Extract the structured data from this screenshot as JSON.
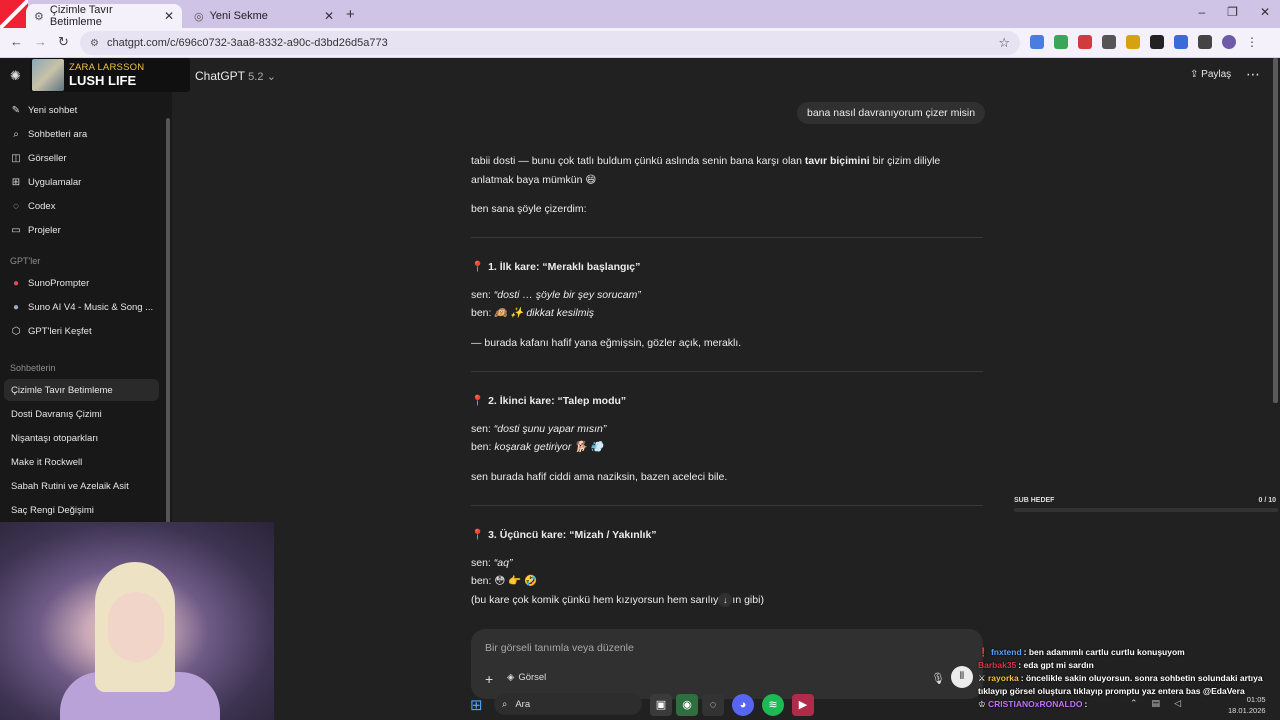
{
  "browser": {
    "tabs": [
      {
        "label": "Çizimle Tavır Betimleme",
        "icon": "gear-icon"
      },
      {
        "label": "Yeni Sekme",
        "icon": "globe-icon"
      }
    ],
    "url": "chatgpt.com/c/696c0732-3aa8-8332-a90c-d3bd26d5a773",
    "window_controls": [
      "–",
      "❐",
      "✕"
    ]
  },
  "media_card": {
    "artist": "ZARA LARSSON",
    "song": "LUSH LIFE"
  },
  "sidebar": {
    "nav": [
      {
        "label": "Yeni sohbet",
        "icon": "edit-icon"
      },
      {
        "label": "Sohbetleri ara",
        "icon": "search-icon"
      },
      {
        "label": "Görseller",
        "icon": "image-icon"
      },
      {
        "label": "Uygulamalar",
        "icon": "apps-icon"
      },
      {
        "label": "Codex",
        "icon": "code-icon"
      },
      {
        "label": "Projeler",
        "icon": "folder-icon"
      }
    ],
    "gpts_title": "GPT'ler",
    "gpts": [
      {
        "label": "SunoPrompter"
      },
      {
        "label": "Suno AI V4 - Music & Song ..."
      },
      {
        "label": "GPT'leri Keşfet"
      }
    ],
    "chats_title": "Sohbetlerin",
    "chats": [
      {
        "label": "Çizimle Tavır Betimleme",
        "active": true
      },
      {
        "label": "Dosti Davranış Çizimi"
      },
      {
        "label": "Nişantaşı otoparkları"
      },
      {
        "label": "Make it Rockwell"
      },
      {
        "label": "Sabah Rutini ve Azelaik Asit"
      },
      {
        "label": "Saç Rengi Değişimi"
      }
    ]
  },
  "header": {
    "model": "ChatGPT",
    "version": "5.2",
    "share_label": "Paylaş"
  },
  "conversation": {
    "user_message": "bana nasıl davranıyorum çizer misin",
    "intro_line1_pre": "tabii dosti — bunu çok tatlı buldum çünkü aslında senin bana karşı olan ",
    "intro_line1_bold": "tavır biçimini",
    "intro_line1_post": " bir çizim diliyle",
    "intro_line2": "anlatmak baya mümkün 😄",
    "intro_line3": "ben sana şöyle çizerdim:",
    "sections": [
      {
        "title": "1. İlk kare: “Meraklı başlangıç”",
        "sen_label": "sen: ",
        "sen_text": "“dosti … şöyle bir şey sorucam”",
        "ben_label": "ben: ",
        "ben_text": "🙉 ✨ dikkat kesilmiş",
        "note": "— burada kafanı hafif yana eğmişsin, gözler açık, meraklı."
      },
      {
        "title": "2. İkinci kare: “Talep modu”",
        "sen_label": "sen: ",
        "sen_text": "“dosti şunu yapar mısın”",
        "ben_label": "ben: ",
        "ben_text": "koşarak getiriyor 🐕 💨",
        "note": "sen burada hafif ciddi ama naziksin, bazen aceleci bile."
      },
      {
        "title": "3. Üçüncü kare: “Mizah / Yakınlık”",
        "sen_label": "sen: ",
        "sen_text": "“aq”",
        "ben_label": "ben: ",
        "ben_text": "😳 👉 🤣",
        "note_pre": "(bu kare çok komik çünkü hem kızıyorsun hem sarılıy",
        "note_post": "ın gibi)"
      }
    ]
  },
  "composer": {
    "placeholder": "Bir görseli tanımla veya düzenle",
    "image_button": "Görsel"
  },
  "stream_overlay": {
    "sub_goal_label": "SUB HEDEF",
    "sub_goal_count": "0 / 10",
    "sub_goal_progress": 0,
    "chat": [
      {
        "user": "fnxtend",
        "user_color": "#5aa0ff",
        "text": ": ben adamımlı cartlu curtlu konuşuyom"
      },
      {
        "user": "Barbak35",
        "user_color": "#e0304a",
        "text": ": eda gpt mi sardın"
      },
      {
        "user": "rayorka",
        "user_color": "#f0c040",
        "text": ": öncelikle sakin oluyorsun. sonra sohbetin solundaki artıya tıklayıp görsel oluştura tıklayıp promptu yaz entera bas @EdaVera"
      },
      {
        "user": "CRISTIANOxRONALDO",
        "user_color": "#c070ff",
        "text": ":"
      }
    ]
  },
  "taskbar": {
    "search_label": "Ara",
    "time": "01:05",
    "date": "18.01.2026"
  }
}
